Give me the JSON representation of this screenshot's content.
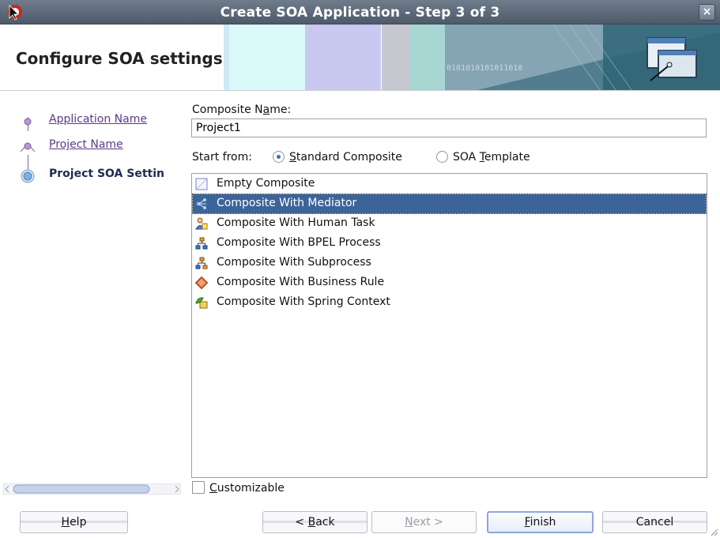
{
  "window": {
    "title": "Create SOA Application - Step 3 of 3",
    "close_label": "×"
  },
  "header": {
    "heading": "Configure SOA settings",
    "deco_text": "0101010101011010"
  },
  "steps": [
    {
      "label": "Application Name",
      "state": "done"
    },
    {
      "label": "Project Name",
      "state": "done"
    },
    {
      "label": "Project SOA Settin",
      "state": "current"
    }
  ],
  "form": {
    "composite_name_label_pre": "Composite N",
    "composite_name_label_mn": "a",
    "composite_name_label_post": "me:",
    "composite_name_value": "Project1",
    "start_from_label": "Start from:",
    "radio_standard_mn": "S",
    "radio_standard_rest": "tandard Composite",
    "radio_template_pre": "SOA ",
    "radio_template_mn": "T",
    "radio_template_rest": "emplate",
    "selected_radio": "Standard Composite",
    "customizable_mn": "C",
    "customizable_rest": "ustomizable",
    "customizable_checked": false
  },
  "templates": [
    {
      "label": "Empty Composite",
      "icon": "empty-composite-icon"
    },
    {
      "label": "Composite With Mediator",
      "icon": "mediator-icon",
      "selected": true
    },
    {
      "label": "Composite With Human Task",
      "icon": "human-task-icon"
    },
    {
      "label": "Composite With BPEL Process",
      "icon": "bpel-process-icon"
    },
    {
      "label": "Composite With Subprocess",
      "icon": "subprocess-icon"
    },
    {
      "label": "Composite With Business Rule",
      "icon": "business-rule-icon"
    },
    {
      "label": "Composite With Spring Context",
      "icon": "spring-context-icon"
    }
  ],
  "buttons": {
    "help_mn": "H",
    "help_rest": "elp",
    "back_pre": "< ",
    "back_mn": "B",
    "back_rest": "ack",
    "next_mn": "N",
    "next_rest": "ext >",
    "finish_mn": "F",
    "finish_rest": "inish",
    "cancel": "Cancel"
  }
}
